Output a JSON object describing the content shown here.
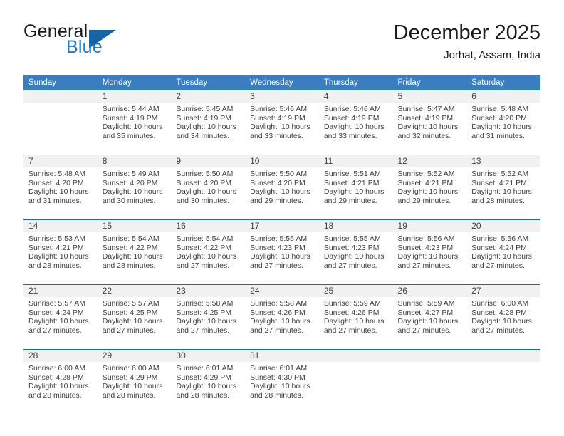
{
  "logo": {
    "word_primary": "General",
    "word_secondary": "Blue",
    "triangle_icon": "triangle-icon",
    "primary_color": "#1a1a1a",
    "secondary_color": "#1f7ac4",
    "triangle_color": "#1664a8"
  },
  "header": {
    "month_title": "December 2025",
    "location": "Jorhat, Assam, India"
  },
  "theme": {
    "header_bg": "#3a7dc0",
    "row_divider": "#1f66ab",
    "daynum_bg": "#f1f1f1",
    "text": "#3d3d3d"
  },
  "weekday_headers": [
    "Sunday",
    "Monday",
    "Tuesday",
    "Wednesday",
    "Thursday",
    "Friday",
    "Saturday"
  ],
  "weeks": [
    [
      {
        "day": "",
        "sunrise": "",
        "sunset": "",
        "daylight_line1": "",
        "daylight_line2": ""
      },
      {
        "day": "1",
        "sunrise": "Sunrise: 5:44 AM",
        "sunset": "Sunset: 4:19 PM",
        "daylight_line1": "Daylight: 10 hours",
        "daylight_line2": "and 35 minutes."
      },
      {
        "day": "2",
        "sunrise": "Sunrise: 5:45 AM",
        "sunset": "Sunset: 4:19 PM",
        "daylight_line1": "Daylight: 10 hours",
        "daylight_line2": "and 34 minutes."
      },
      {
        "day": "3",
        "sunrise": "Sunrise: 5:46 AM",
        "sunset": "Sunset: 4:19 PM",
        "daylight_line1": "Daylight: 10 hours",
        "daylight_line2": "and 33 minutes."
      },
      {
        "day": "4",
        "sunrise": "Sunrise: 5:46 AM",
        "sunset": "Sunset: 4:19 PM",
        "daylight_line1": "Daylight: 10 hours",
        "daylight_line2": "and 33 minutes."
      },
      {
        "day": "5",
        "sunrise": "Sunrise: 5:47 AM",
        "sunset": "Sunset: 4:19 PM",
        "daylight_line1": "Daylight: 10 hours",
        "daylight_line2": "and 32 minutes."
      },
      {
        "day": "6",
        "sunrise": "Sunrise: 5:48 AM",
        "sunset": "Sunset: 4:20 PM",
        "daylight_line1": "Daylight: 10 hours",
        "daylight_line2": "and 31 minutes."
      }
    ],
    [
      {
        "day": "7",
        "sunrise": "Sunrise: 5:48 AM",
        "sunset": "Sunset: 4:20 PM",
        "daylight_line1": "Daylight: 10 hours",
        "daylight_line2": "and 31 minutes."
      },
      {
        "day": "8",
        "sunrise": "Sunrise: 5:49 AM",
        "sunset": "Sunset: 4:20 PM",
        "daylight_line1": "Daylight: 10 hours",
        "daylight_line2": "and 30 minutes."
      },
      {
        "day": "9",
        "sunrise": "Sunrise: 5:50 AM",
        "sunset": "Sunset: 4:20 PM",
        "daylight_line1": "Daylight: 10 hours",
        "daylight_line2": "and 30 minutes."
      },
      {
        "day": "10",
        "sunrise": "Sunrise: 5:50 AM",
        "sunset": "Sunset: 4:20 PM",
        "daylight_line1": "Daylight: 10 hours",
        "daylight_line2": "and 29 minutes."
      },
      {
        "day": "11",
        "sunrise": "Sunrise: 5:51 AM",
        "sunset": "Sunset: 4:21 PM",
        "daylight_line1": "Daylight: 10 hours",
        "daylight_line2": "and 29 minutes."
      },
      {
        "day": "12",
        "sunrise": "Sunrise: 5:52 AM",
        "sunset": "Sunset: 4:21 PM",
        "daylight_line1": "Daylight: 10 hours",
        "daylight_line2": "and 29 minutes."
      },
      {
        "day": "13",
        "sunrise": "Sunrise: 5:52 AM",
        "sunset": "Sunset: 4:21 PM",
        "daylight_line1": "Daylight: 10 hours",
        "daylight_line2": "and 28 minutes."
      }
    ],
    [
      {
        "day": "14",
        "sunrise": "Sunrise: 5:53 AM",
        "sunset": "Sunset: 4:21 PM",
        "daylight_line1": "Daylight: 10 hours",
        "daylight_line2": "and 28 minutes."
      },
      {
        "day": "15",
        "sunrise": "Sunrise: 5:54 AM",
        "sunset": "Sunset: 4:22 PM",
        "daylight_line1": "Daylight: 10 hours",
        "daylight_line2": "and 28 minutes."
      },
      {
        "day": "16",
        "sunrise": "Sunrise: 5:54 AM",
        "sunset": "Sunset: 4:22 PM",
        "daylight_line1": "Daylight: 10 hours",
        "daylight_line2": "and 27 minutes."
      },
      {
        "day": "17",
        "sunrise": "Sunrise: 5:55 AM",
        "sunset": "Sunset: 4:23 PM",
        "daylight_line1": "Daylight: 10 hours",
        "daylight_line2": "and 27 minutes."
      },
      {
        "day": "18",
        "sunrise": "Sunrise: 5:55 AM",
        "sunset": "Sunset: 4:23 PM",
        "daylight_line1": "Daylight: 10 hours",
        "daylight_line2": "and 27 minutes."
      },
      {
        "day": "19",
        "sunrise": "Sunrise: 5:56 AM",
        "sunset": "Sunset: 4:23 PM",
        "daylight_line1": "Daylight: 10 hours",
        "daylight_line2": "and 27 minutes."
      },
      {
        "day": "20",
        "sunrise": "Sunrise: 5:56 AM",
        "sunset": "Sunset: 4:24 PM",
        "daylight_line1": "Daylight: 10 hours",
        "daylight_line2": "and 27 minutes."
      }
    ],
    [
      {
        "day": "21",
        "sunrise": "Sunrise: 5:57 AM",
        "sunset": "Sunset: 4:24 PM",
        "daylight_line1": "Daylight: 10 hours",
        "daylight_line2": "and 27 minutes."
      },
      {
        "day": "22",
        "sunrise": "Sunrise: 5:57 AM",
        "sunset": "Sunset: 4:25 PM",
        "daylight_line1": "Daylight: 10 hours",
        "daylight_line2": "and 27 minutes."
      },
      {
        "day": "23",
        "sunrise": "Sunrise: 5:58 AM",
        "sunset": "Sunset: 4:25 PM",
        "daylight_line1": "Daylight: 10 hours",
        "daylight_line2": "and 27 minutes."
      },
      {
        "day": "24",
        "sunrise": "Sunrise: 5:58 AM",
        "sunset": "Sunset: 4:26 PM",
        "daylight_line1": "Daylight: 10 hours",
        "daylight_line2": "and 27 minutes."
      },
      {
        "day": "25",
        "sunrise": "Sunrise: 5:59 AM",
        "sunset": "Sunset: 4:26 PM",
        "daylight_line1": "Daylight: 10 hours",
        "daylight_line2": "and 27 minutes."
      },
      {
        "day": "26",
        "sunrise": "Sunrise: 5:59 AM",
        "sunset": "Sunset: 4:27 PM",
        "daylight_line1": "Daylight: 10 hours",
        "daylight_line2": "and 27 minutes."
      },
      {
        "day": "27",
        "sunrise": "Sunrise: 6:00 AM",
        "sunset": "Sunset: 4:28 PM",
        "daylight_line1": "Daylight: 10 hours",
        "daylight_line2": "and 27 minutes."
      }
    ],
    [
      {
        "day": "28",
        "sunrise": "Sunrise: 6:00 AM",
        "sunset": "Sunset: 4:28 PM",
        "daylight_line1": "Daylight: 10 hours",
        "daylight_line2": "and 28 minutes."
      },
      {
        "day": "29",
        "sunrise": "Sunrise: 6:00 AM",
        "sunset": "Sunset: 4:29 PM",
        "daylight_line1": "Daylight: 10 hours",
        "daylight_line2": "and 28 minutes."
      },
      {
        "day": "30",
        "sunrise": "Sunrise: 6:01 AM",
        "sunset": "Sunset: 4:29 PM",
        "daylight_line1": "Daylight: 10 hours",
        "daylight_line2": "and 28 minutes."
      },
      {
        "day": "31",
        "sunrise": "Sunrise: 6:01 AM",
        "sunset": "Sunset: 4:30 PM",
        "daylight_line1": "Daylight: 10 hours",
        "daylight_line2": "and 28 minutes."
      },
      {
        "day": "",
        "sunrise": "",
        "sunset": "",
        "daylight_line1": "",
        "daylight_line2": ""
      },
      {
        "day": "",
        "sunrise": "",
        "sunset": "",
        "daylight_line1": "",
        "daylight_line2": ""
      },
      {
        "day": "",
        "sunrise": "",
        "sunset": "",
        "daylight_line1": "",
        "daylight_line2": ""
      }
    ]
  ]
}
